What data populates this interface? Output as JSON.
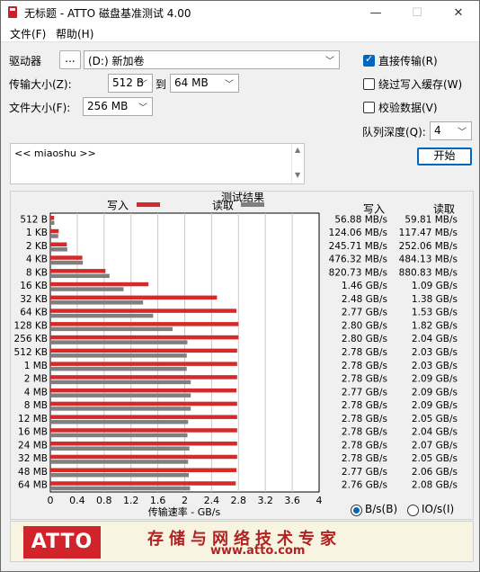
{
  "window": {
    "title": "无标题 - ATTO 磁盘基准测试 4.00",
    "min_glyph": "—",
    "max_glyph": "☐",
    "close_glyph": "✕"
  },
  "menu": {
    "file": "文件(F)",
    "help": "帮助(H)"
  },
  "settings": {
    "drive_label": "驱动器",
    "browse_button": "...",
    "drive_value": "(D:) 新加卷",
    "transfer_size_label": "传输大小(Z):",
    "transfer_from": "512 B",
    "to_label": "到",
    "transfer_to": "64 MB",
    "file_size_label": "文件大小(F):",
    "file_size": "256 MB"
  },
  "options": {
    "direct_io": {
      "label": "直接传输(R)",
      "checked": true
    },
    "bypass_write_cache": {
      "label": "绕过写入缓存(W)",
      "checked": false
    },
    "verify_data": {
      "label": "校验数据(V)",
      "checked": false
    },
    "queue_depth_label": "队列深度(Q):",
    "queue_depth": "4",
    "start_button": "开始"
  },
  "description": {
    "text": "<< miaoshu >>"
  },
  "results": {
    "title": "测试结果",
    "write_legend": "写入",
    "read_legend": "读取",
    "write_col": "写入",
    "read_col": "读取",
    "rows": [
      {
        "size": "512 B",
        "write": "56.88 MB/s",
        "read": "59.81 MB/s"
      },
      {
        "size": "1 KB",
        "write": "124.06 MB/s",
        "read": "117.47 MB/s"
      },
      {
        "size": "2 KB",
        "write": "245.71 MB/s",
        "read": "252.06 MB/s"
      },
      {
        "size": "4 KB",
        "write": "476.32 MB/s",
        "read": "484.13 MB/s"
      },
      {
        "size": "8 KB",
        "write": "820.73 MB/s",
        "read": "880.83 MB/s"
      },
      {
        "size": "16 KB",
        "write": "1.46 GB/s",
        "read": "1.09 GB/s"
      },
      {
        "size": "32 KB",
        "write": "2.48 GB/s",
        "read": "1.38 GB/s"
      },
      {
        "size": "64 KB",
        "write": "2.77 GB/s",
        "read": "1.53 GB/s"
      },
      {
        "size": "128 KB",
        "write": "2.80 GB/s",
        "read": "1.82 GB/s"
      },
      {
        "size": "256 KB",
        "write": "2.80 GB/s",
        "read": "2.04 GB/s"
      },
      {
        "size": "512 KB",
        "write": "2.78 GB/s",
        "read": "2.03 GB/s"
      },
      {
        "size": "1 MB",
        "write": "2.78 GB/s",
        "read": "2.03 GB/s"
      },
      {
        "size": "2 MB",
        "write": "2.78 GB/s",
        "read": "2.09 GB/s"
      },
      {
        "size": "4 MB",
        "write": "2.77 GB/s",
        "read": "2.09 GB/s"
      },
      {
        "size": "8 MB",
        "write": "2.78 GB/s",
        "read": "2.09 GB/s"
      },
      {
        "size": "12 MB",
        "write": "2.78 GB/s",
        "read": "2.05 GB/s"
      },
      {
        "size": "16 MB",
        "write": "2.78 GB/s",
        "read": "2.04 GB/s"
      },
      {
        "size": "24 MB",
        "write": "2.78 GB/s",
        "read": "2.07 GB/s"
      },
      {
        "size": "32 MB",
        "write": "2.78 GB/s",
        "read": "2.05 GB/s"
      },
      {
        "size": "48 MB",
        "write": "2.77 GB/s",
        "read": "2.06 GB/s"
      },
      {
        "size": "64 MB",
        "write": "2.76 GB/s",
        "read": "2.08 GB/s"
      }
    ],
    "units": {
      "bytes": {
        "label": "B/s(B)",
        "selected": true
      },
      "io": {
        "label": "IO/s(I)",
        "selected": false
      }
    }
  },
  "chart_data": {
    "type": "bar",
    "orientation": "horizontal",
    "title": "测试结果",
    "xlabel": "传输速率 - GB/s",
    "ylabel": "",
    "xlim": [
      0,
      4
    ],
    "xticks": [
      "0",
      "0.4",
      "0.8",
      "1.2",
      "1.6",
      "2",
      "2.4",
      "2.8",
      "3.2",
      "3.6",
      "4"
    ],
    "grid": true,
    "legend": "top",
    "categories": [
      "512 B",
      "1 KB",
      "2 KB",
      "4 KB",
      "8 KB",
      "16 KB",
      "32 KB",
      "64 KB",
      "128 KB",
      "256 KB",
      "512 KB",
      "1 MB",
      "2 MB",
      "4 MB",
      "8 MB",
      "12 MB",
      "16 MB",
      "24 MB",
      "32 MB",
      "48 MB",
      "64 MB"
    ],
    "series": [
      {
        "name": "写入",
        "color": "#d42a2a",
        "values": [
          0.05688,
          0.12406,
          0.24571,
          0.47632,
          0.82073,
          1.46,
          2.48,
          2.77,
          2.8,
          2.8,
          2.78,
          2.78,
          2.78,
          2.77,
          2.78,
          2.78,
          2.78,
          2.78,
          2.78,
          2.77,
          2.76
        ]
      },
      {
        "name": "读取",
        "color": "#7f7f7f",
        "values": [
          0.05981,
          0.11747,
          0.25206,
          0.48413,
          0.88083,
          1.09,
          1.38,
          1.53,
          1.82,
          2.04,
          2.03,
          2.03,
          2.09,
          2.09,
          2.09,
          2.05,
          2.04,
          2.07,
          2.05,
          2.06,
          2.08
        ]
      }
    ]
  },
  "banner": {
    "logo": "ATTO",
    "slogan": "存储与网络技术专家",
    "url": "www.atto.com",
    "logo_color": "#d0242a",
    "text_color": "#b22222"
  }
}
